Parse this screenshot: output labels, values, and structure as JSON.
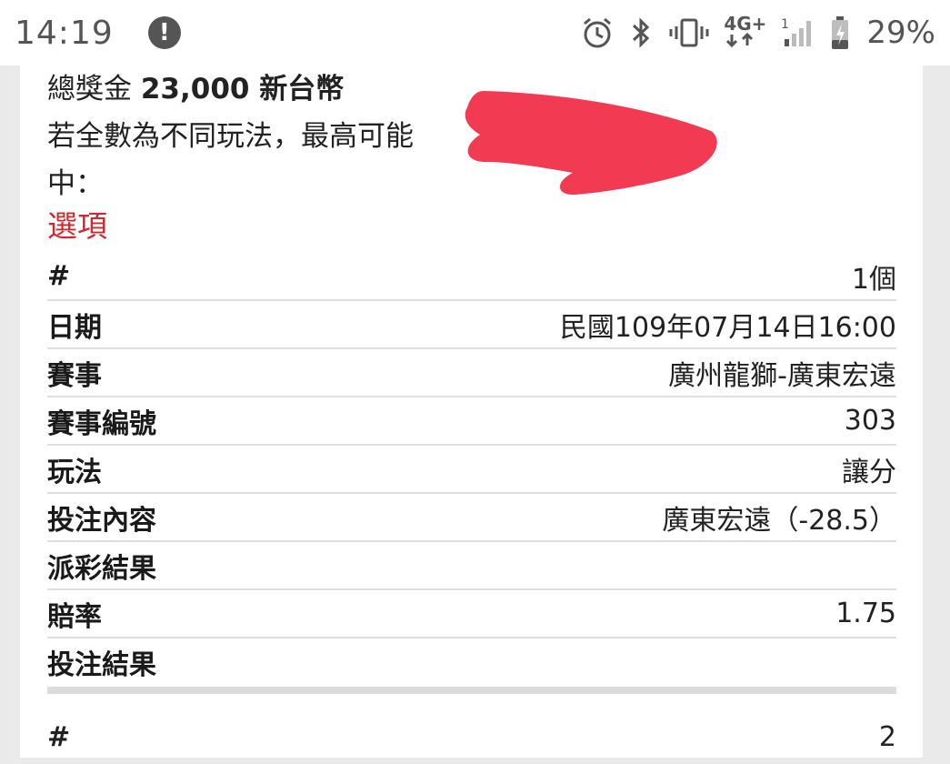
{
  "status_bar": {
    "time": "14:19",
    "alert_symbol": "!",
    "icons": [
      "alarm-icon",
      "bluetooth-icon",
      "vibrate-icon",
      "4g-data-icon",
      "signal-icon",
      "battery-charging-icon"
    ],
    "network_label": "4G+",
    "sim_slot": "1",
    "battery_percent": "29%"
  },
  "summary": {
    "total_prize_label": "總獎金",
    "total_prize_value": "23,000 新台幣",
    "note": "若全數為不同玩法，最高可能中："
  },
  "options_title": "選項",
  "bets": [
    {
      "rows": [
        {
          "label": "#",
          "value": "1個"
        },
        {
          "label": "日期",
          "value": "民國109年07月14日16:00"
        },
        {
          "label": "賽事",
          "value": "廣州龍獅-廣東宏遠"
        },
        {
          "label": "賽事編號",
          "value": "303"
        },
        {
          "label": "玩法",
          "value": "讓分"
        },
        {
          "label": "投注內容",
          "value": "廣東宏遠（-28.5）"
        },
        {
          "label": "派彩結果",
          "value": ""
        },
        {
          "label": "賠率",
          "value": "1.75"
        },
        {
          "label": "投注結果",
          "value": ""
        }
      ]
    },
    {
      "rows": [
        {
          "label": "#",
          "value": "2"
        }
      ]
    }
  ],
  "colors": {
    "accent_red": "#d0282e",
    "redaction": "#f23a52"
  }
}
